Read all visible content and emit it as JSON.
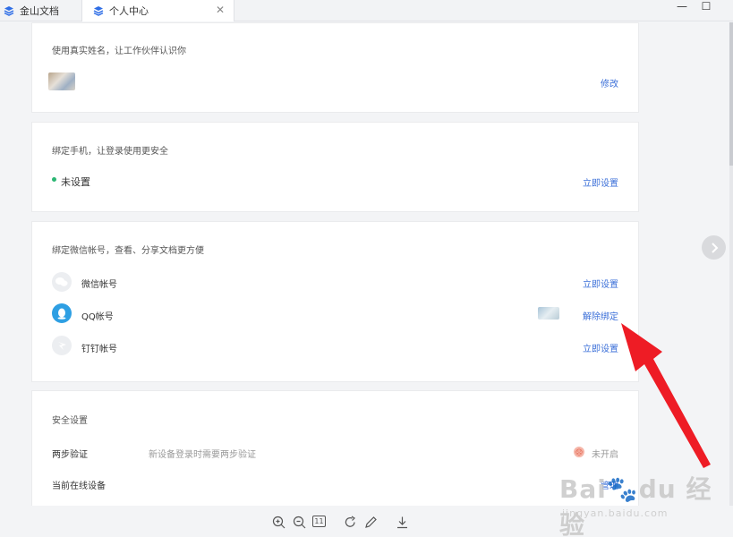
{
  "tabs": [
    {
      "label": "金山文档"
    },
    {
      "label": "个人中心"
    }
  ],
  "window_controls": {
    "minimize": "—",
    "maximize": "☐"
  },
  "name_card": {
    "title": "使用真实姓名，让工作伙伴认识你",
    "action": "修改"
  },
  "phone_card": {
    "title": "绑定手机，让登录使用更安全",
    "status": "未设置",
    "action": "立即设置"
  },
  "bind_card": {
    "title": "绑定微信帐号，查看、分享文档更方便",
    "rows": [
      {
        "label": "微信帐号",
        "action": "立即设置",
        "icon": "wechat-icon"
      },
      {
        "label": "QQ帐号",
        "action": "解除绑定",
        "icon": "qq-icon"
      },
      {
        "label": "钉钉帐号",
        "action": "立即设置",
        "icon": "dingtalk-icon"
      }
    ]
  },
  "security_card": {
    "title": "安全设置",
    "two_step_label": "两步验证",
    "two_step_desc": "新设备登录时需要两步验证",
    "two_step_status": "未开启",
    "online_devices_label": "当前在线设备",
    "online_devices_action": "管理"
  },
  "toolbar": [
    "zoom-in-icon",
    "zoom-out-icon",
    "actual-size-icon",
    "rotate-icon",
    "edit-icon",
    "download-icon"
  ],
  "toolbar_actual_size": "11",
  "watermark": {
    "logo": "Bai du 经验",
    "url": "jingyan.baidu.com"
  },
  "colors": {
    "link": "#3b6fd8",
    "accent_green": "#2bb673",
    "qq_blue": "#2e9fe3",
    "annotation_red": "#ee1c25"
  }
}
